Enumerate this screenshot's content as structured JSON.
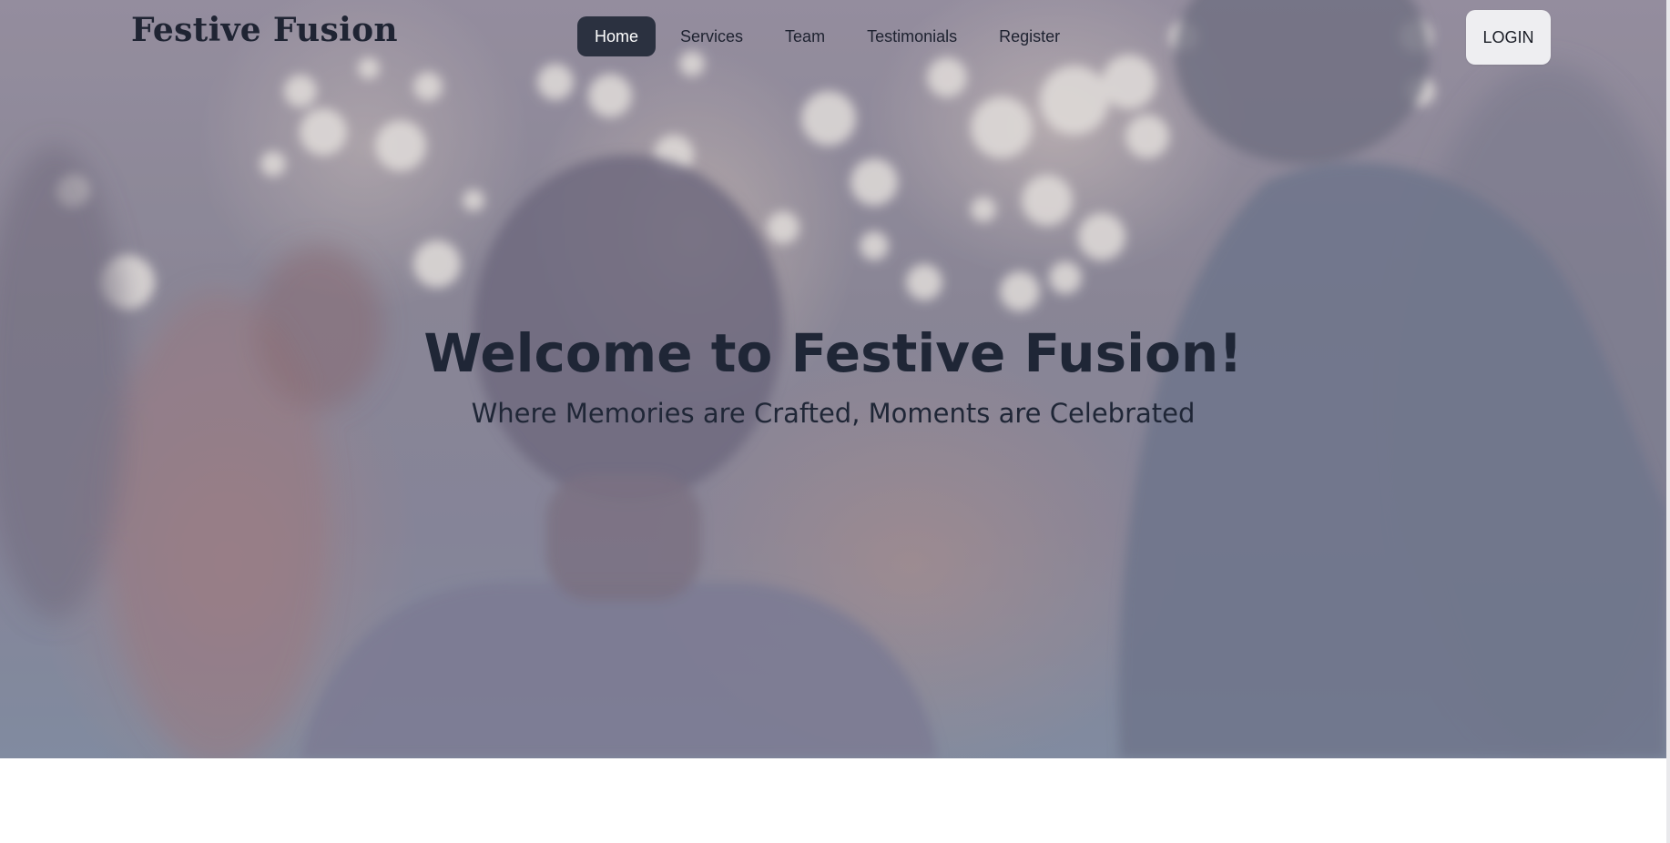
{
  "brand": {
    "name": "Festive Fusion"
  },
  "nav": {
    "items": [
      {
        "label": "Home",
        "active": true
      },
      {
        "label": "Services",
        "active": false
      },
      {
        "label": "Team",
        "active": false
      },
      {
        "label": "Testimonials",
        "active": false
      },
      {
        "label": "Register",
        "active": false
      }
    ],
    "login_label": "LOGIN"
  },
  "hero": {
    "title": "Welcome to Festive Fusion!",
    "subtitle": "Where Memories are Crafted, Moments are Celebrated",
    "background_image": "wedding-celebration-sparklers-photo"
  },
  "colors": {
    "nav_active_bg": "#2b3140",
    "text_dark": "#1f2636",
    "login_bg": "#eeeef1"
  }
}
